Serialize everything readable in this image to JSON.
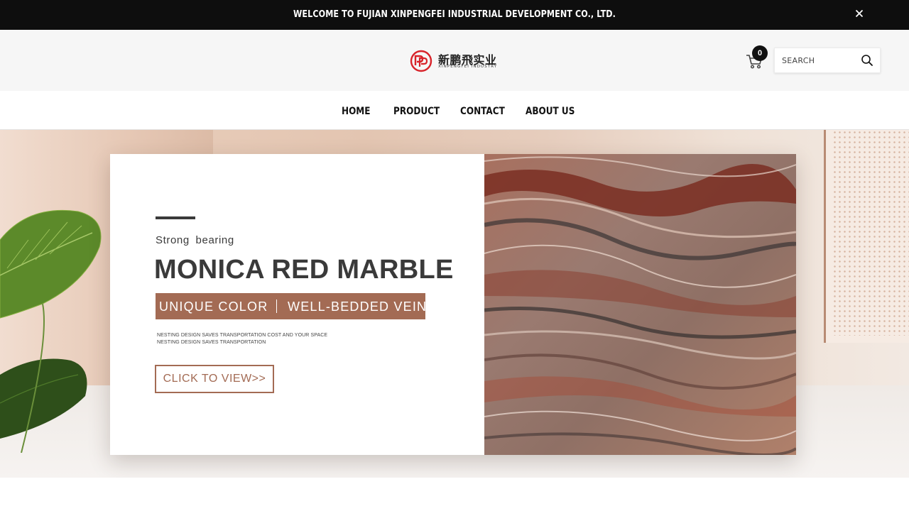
{
  "announcement": {
    "text": "WELCOME TO FUJIAN XINPENGFEI INDUSTRIAL DEVELOPMENT CO., LTD."
  },
  "header": {
    "logo_cn": "新鹏飛实业",
    "logo_en": "XINPENGFEI INDUSTRY",
    "cart_count": "0",
    "search_placeholder": "SEARCH"
  },
  "nav": {
    "items": [
      {
        "label": "HOME"
      },
      {
        "label": "PRODUCT"
      },
      {
        "label": "CONTACT"
      },
      {
        "label": "ABOUT US"
      }
    ]
  },
  "hero": {
    "subtitle": "Strong  bearing",
    "title": "MONICA RED MARBLE",
    "band_left": "UNIQUE COLOR",
    "band_right": "WELL-BEDDED VEIN",
    "note_1": "NESTING DESIGN SAVES TRANSPORTATION COST AND YOUR SPACE",
    "note_2": "NESTING DESIGN SAVES TRANSPORTATION",
    "cta": "CLICK TO VIEW>>"
  },
  "colors": {
    "announcement_bg": "#0e0e0e",
    "header_bg": "#f6f6f6",
    "accent": "#a36b54",
    "logo_red": "#d8232a"
  },
  "icons": {
    "close": "close-icon",
    "cart": "cart-icon",
    "search": "search-icon",
    "logo": "logo-mark-icon"
  }
}
